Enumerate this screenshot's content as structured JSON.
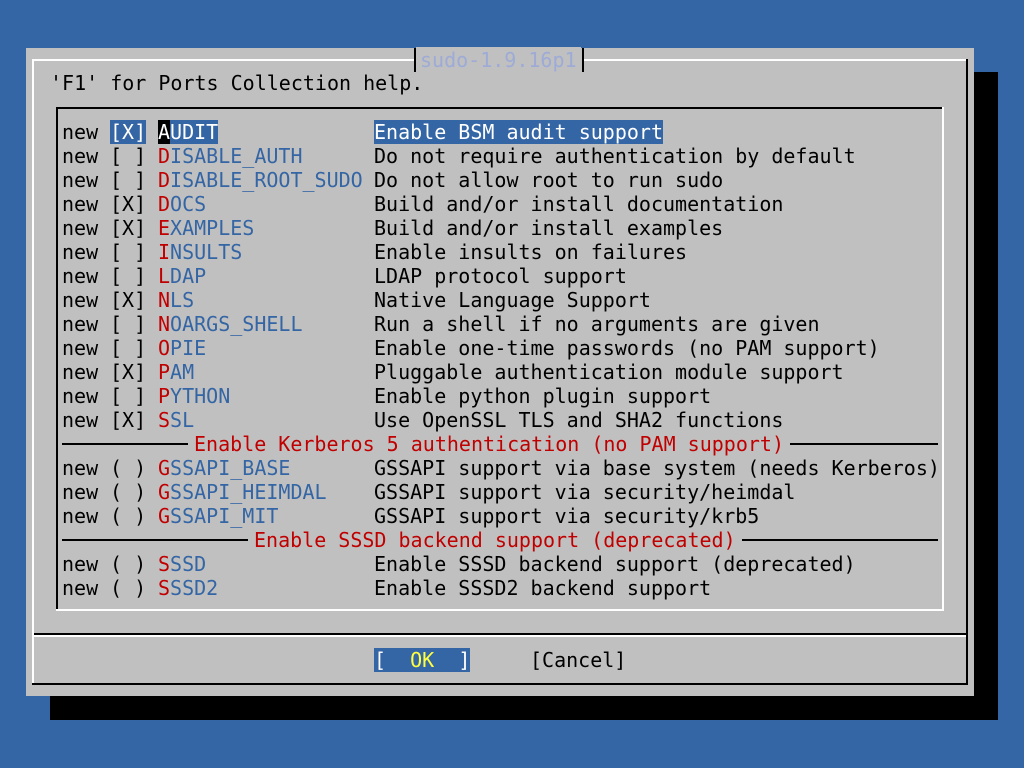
{
  "dialog": {
    "title": "sudo-1.9.16p1",
    "help": "'F1' for Ports Collection help."
  },
  "options": [
    {
      "status": "new",
      "box": "[X]",
      "hot": "A",
      "rest": "UDIT",
      "desc": "Enable BSM audit support",
      "selected": true
    },
    {
      "status": "new",
      "box": "[ ]",
      "hot": "D",
      "rest": "ISABLE_AUTH",
      "desc": "Do not require authentication by default"
    },
    {
      "status": "new",
      "box": "[ ]",
      "hot": "D",
      "rest": "ISABLE_ROOT_SUDO",
      "desc": "Do not allow root to run sudo"
    },
    {
      "status": "new",
      "box": "[X]",
      "hot": "D",
      "rest": "OCS",
      "desc": "Build and/or install documentation"
    },
    {
      "status": "new",
      "box": "[X]",
      "hot": "E",
      "rest": "XAMPLES",
      "desc": "Build and/or install examples"
    },
    {
      "status": "new",
      "box": "[ ]",
      "hot": "I",
      "rest": "NSULTS",
      "desc": "Enable insults on failures"
    },
    {
      "status": "new",
      "box": "[ ]",
      "hot": "L",
      "rest": "DAP",
      "desc": "LDAP protocol support"
    },
    {
      "status": "new",
      "box": "[X]",
      "hot": "N",
      "rest": "LS",
      "desc": "Native Language Support"
    },
    {
      "status": "new",
      "box": "[ ]",
      "hot": "N",
      "rest": "OARGS_SHELL",
      "desc": "Run a shell if no arguments are given"
    },
    {
      "status": "new",
      "box": "[ ]",
      "hot": "O",
      "rest": "PIE",
      "desc": "Enable one-time passwords (no PAM support)"
    },
    {
      "status": "new",
      "box": "[X]",
      "hot": "P",
      "rest": "AM",
      "desc": "Pluggable authentication module support"
    },
    {
      "status": "new",
      "box": "[ ]",
      "hot": "P",
      "rest": "YTHON",
      "desc": "Enable python plugin support"
    },
    {
      "status": "new",
      "box": "[X]",
      "hot": "S",
      "rest": "SL",
      "desc": "Use OpenSSL TLS and SHA2 functions"
    }
  ],
  "groups": [
    {
      "label": "Enable Kerberos 5 authentication (no PAM support)",
      "options": [
        {
          "status": "new",
          "box": "( )",
          "hot": "G",
          "rest": "SSAPI_BASE",
          "desc": "GSSAPI support via base system (needs Kerberos)"
        },
        {
          "status": "new",
          "box": "( )",
          "hot": "G",
          "rest": "SSAPI_HEIMDAL",
          "desc": "GSSAPI support via security/heimdal"
        },
        {
          "status": "new",
          "box": "( )",
          "hot": "G",
          "rest": "SSAPI_MIT",
          "desc": "GSSAPI support via security/krb5"
        }
      ]
    },
    {
      "label": "Enable SSSD backend support (deprecated)",
      "options": [
        {
          "status": "new",
          "box": "( )",
          "hot": "S",
          "rest": "SSD",
          "desc": "Enable SSSD backend support (deprecated)"
        },
        {
          "status": "new",
          "box": "( )",
          "hot": "S",
          "rest": "SSD2",
          "desc": "Enable SSSD2 backend support"
        }
      ]
    }
  ],
  "buttons": {
    "ok_left": "[",
    "ok_label": "OK",
    "ok_right": "]",
    "cancel_label": "[Cancel]"
  }
}
